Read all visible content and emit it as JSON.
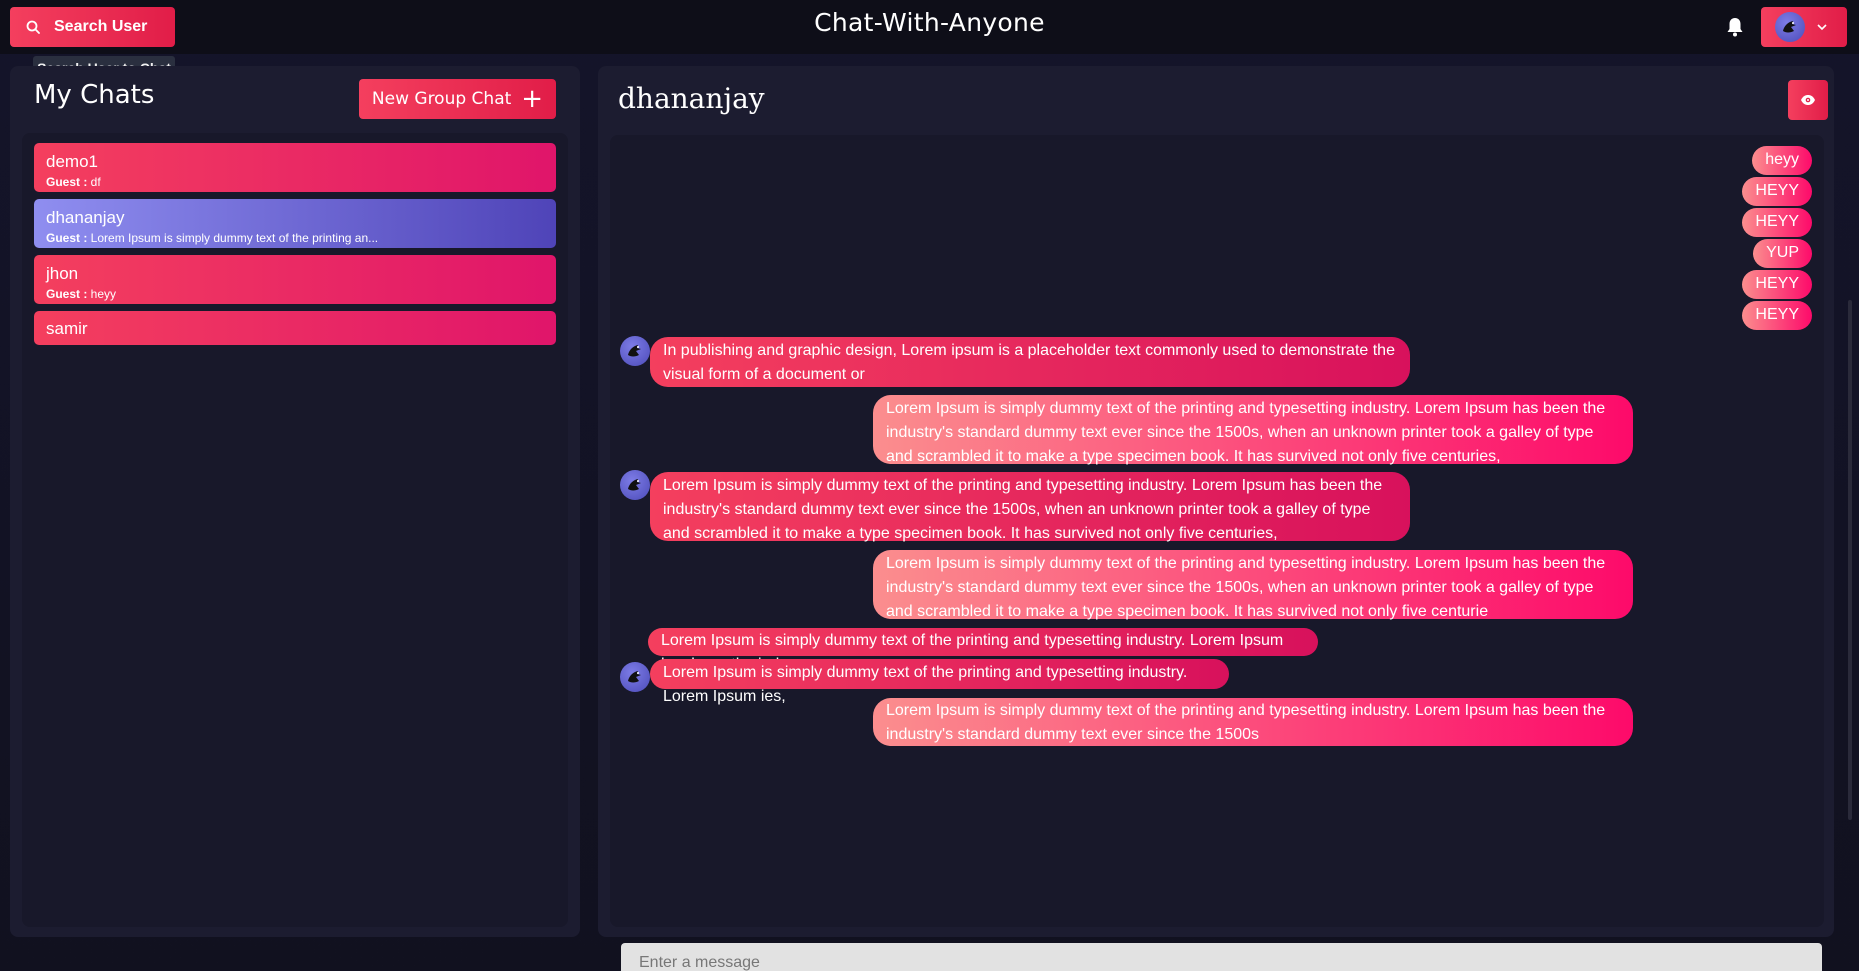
{
  "header": {
    "search_label": "Search User",
    "search_tooltip": "Search User to Chat",
    "app_title": "Chat-With-Anyone",
    "icons": {
      "search": "search-icon",
      "bell": "bell-icon",
      "chevron": "chevron-down-icon"
    }
  },
  "sidebar": {
    "title": "My Chats",
    "new_group_label": "New Group Chat",
    "new_group_icon": "+",
    "chats": [
      {
        "name": "demo1",
        "sender": "Guest :",
        "preview": " df"
      },
      {
        "name": "dhananjay",
        "sender": "Guest :",
        "preview": " Lorem Ipsum is simply dummy text of the printing an..."
      },
      {
        "name": "jhon",
        "sender": "Guest :",
        "preview": " heyy"
      },
      {
        "name": "samir",
        "sender": "",
        "preview": ""
      }
    ]
  },
  "chat": {
    "title": "dhananjay",
    "input_placeholder": "Enter a message",
    "messages": [
      {
        "side": "sent",
        "text": "heyy"
      },
      {
        "side": "sent",
        "text": "HEYY"
      },
      {
        "side": "sent",
        "text": "HEYY"
      },
      {
        "side": "sent",
        "text": "YUP"
      },
      {
        "side": "sent",
        "text": "HEYY"
      },
      {
        "side": "sent",
        "text": "HEYY"
      },
      {
        "side": "recv",
        "text": "In publishing and graphic design, Lorem ipsum is a placeholder text commonly used to demonstrate the visual form of a document or"
      },
      {
        "side": "sent",
        "text": "Lorem Ipsum is simply dummy text of the printing and typesetting industry. Lorem Ipsum has been the industry's standard dummy text ever since the 1500s, when an unknown printer took a galley of type and scrambled it to make a type specimen book. It has survived not only five centuries,"
      },
      {
        "side": "recv",
        "text": "Lorem Ipsum is simply dummy text of the printing and typesetting industry. Lorem Ipsum has been the industry's standard dummy text ever since the 1500s, when an unknown printer took a galley of type and scrambled it to make a type specimen book. It has survived not only five centuries,"
      },
      {
        "side": "sent",
        "text": "Lorem Ipsum is simply dummy text of the printing and typesetting industry. Lorem Ipsum has been the industry's standard dummy text ever since the 1500s, when an unknown printer took a galley of type and scrambled it to make a type specimen book. It has survived not only five centurie"
      },
      {
        "side": "recv",
        "text": "Lorem Ipsum is simply dummy text of the printing and typesetting industry. Lorem Ipsum has been the indus"
      },
      {
        "side": "recv",
        "text": "Lorem Ipsum is simply dummy text of the printing and typesetting industry. Lorem Ipsum ies,"
      },
      {
        "side": "sent",
        "text": "Lorem Ipsum is simply dummy text of the printing and typesetting industry. Lorem Ipsum has been the industry's standard dummy text ever since the 1500s"
      }
    ]
  },
  "colors": {
    "accent": "#f43f5e",
    "accent_dark": "#e11d48",
    "active_chat": "#6b66d6",
    "panel": "#1c1c30",
    "background": "#11111f"
  }
}
